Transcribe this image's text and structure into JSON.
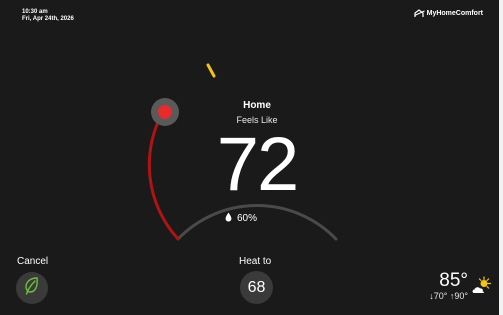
{
  "status": {
    "time": "10:30 am",
    "date": "Fri, Apr 24th, 2026"
  },
  "brand": {
    "name": "MyHomeComfort"
  },
  "thermostat": {
    "mode_title": "Home",
    "feels_like_label": "Feels Like",
    "current_temp": "72",
    "humidity": "60%",
    "heat_arc_color": "#b01313",
    "setpoint_marker_color": "#e52b2b",
    "ambient_marker_color": "#f2c318"
  },
  "controls": {
    "cancel_label": "Cancel",
    "leaf_icon": "leaf-icon",
    "heat_to_label": "Heat to",
    "heat_setpoint": "68"
  },
  "weather": {
    "outdoor_temp": "85°",
    "low": "↓70°",
    "high": "↑90°",
    "icon": "partly-cloudy-sun-icon"
  }
}
